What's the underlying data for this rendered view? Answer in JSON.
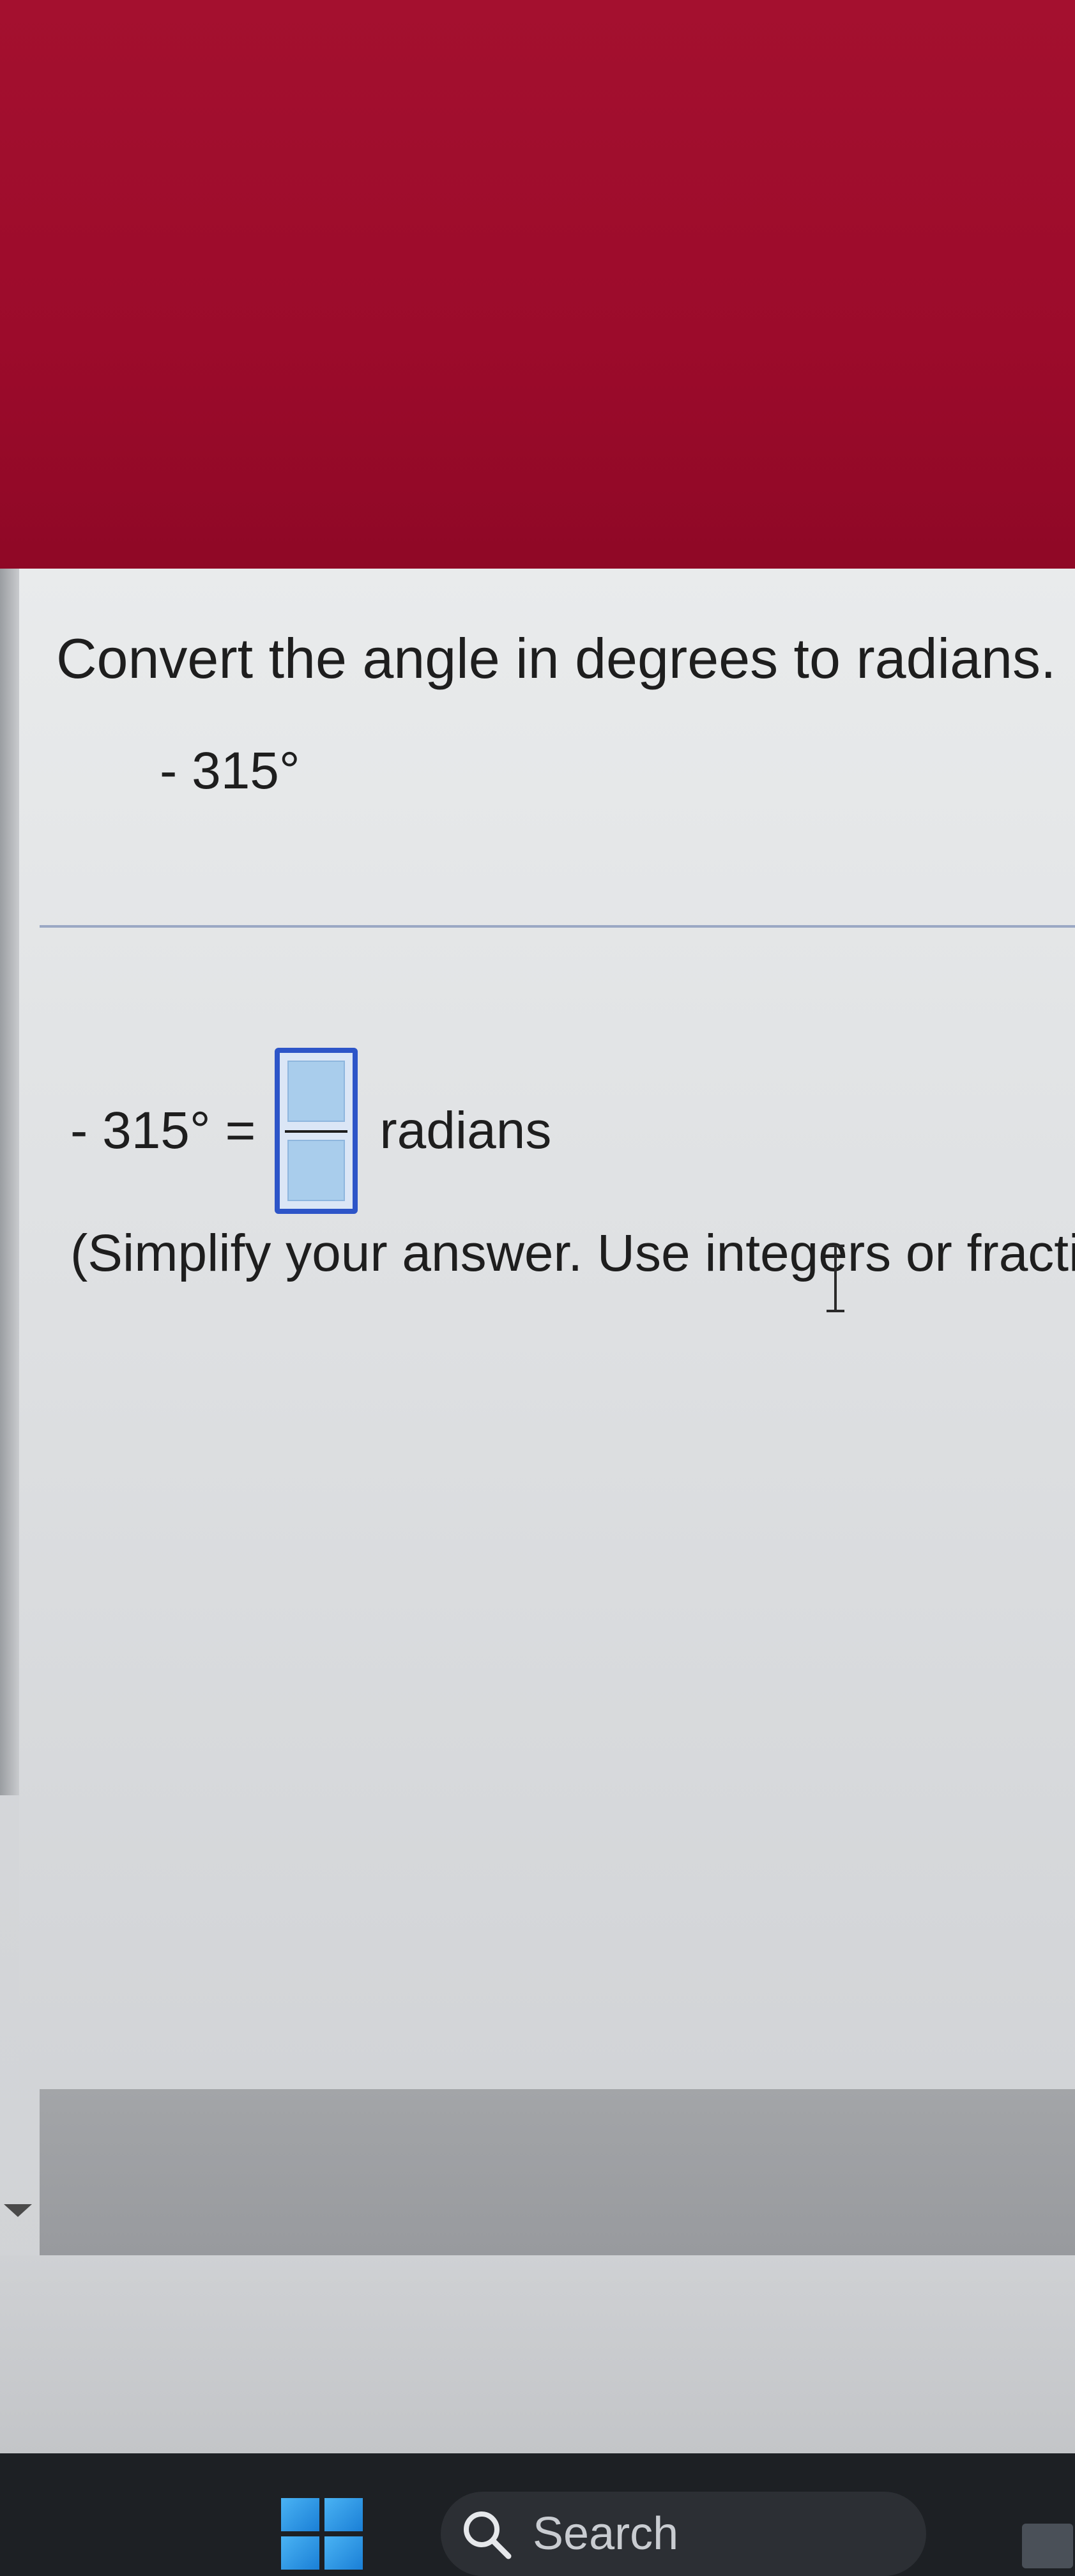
{
  "question": {
    "title": "Convert the angle in degrees to radians.",
    "given_angle": "- 315°"
  },
  "answer": {
    "lhs": "- 315° =",
    "unit": "radians",
    "numerator_value": "",
    "denominator_value": "",
    "instruction": "(Simplify your answer. Use integers or fractic"
  },
  "taskbar": {
    "search_label": "Search"
  },
  "colors": {
    "banner": "#9c0b2b",
    "answer_box_border": "#2d55c8",
    "answer_slot_fill": "#a9cdec"
  }
}
